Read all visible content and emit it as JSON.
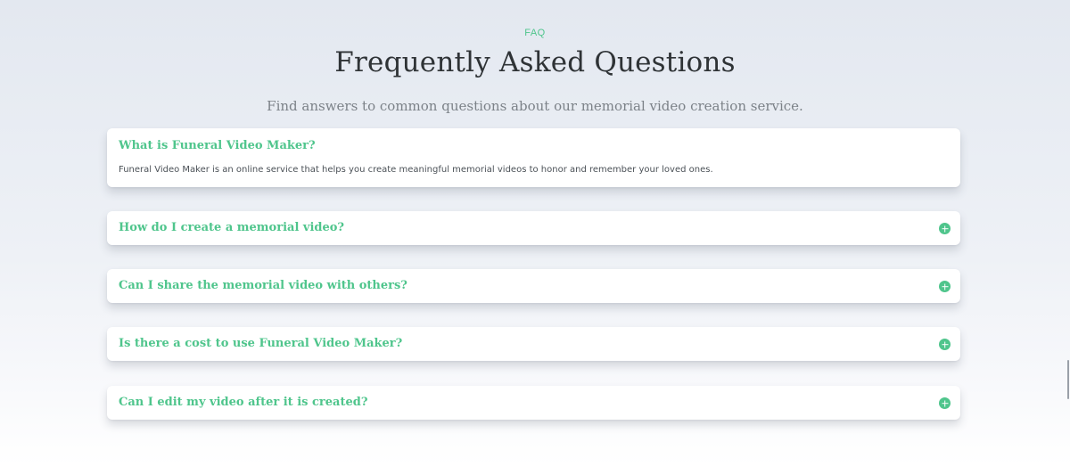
{
  "faq_section": {
    "eyebrow": "FAQ",
    "title": "Frequently Asked Questions",
    "subtitle": "Find answers to common questions about our memorial video creation service.",
    "items": [
      {
        "question": "What is Funeral Video Maker?",
        "answer": "Funeral Video Maker is an online service that helps you create meaningful memorial videos to honor and remember your loved ones.",
        "expanded": true
      },
      {
        "question": "How do I create a memorial video?",
        "expanded": false,
        "icon": "plus-circle-icon"
      },
      {
        "question": "Can I share the memorial video with others?",
        "expanded": false,
        "icon": "plus-circle-icon"
      },
      {
        "question": "Is there a cost to use Funeral Video Maker?",
        "expanded": false,
        "icon": "plus-circle-icon"
      },
      {
        "question": "Can I edit my video after it is created?",
        "expanded": false,
        "icon": "plus-circle-icon"
      }
    ]
  },
  "colors": {
    "accent": "#4fc58c",
    "title": "#2f3336",
    "subtitle": "#7c8288"
  }
}
